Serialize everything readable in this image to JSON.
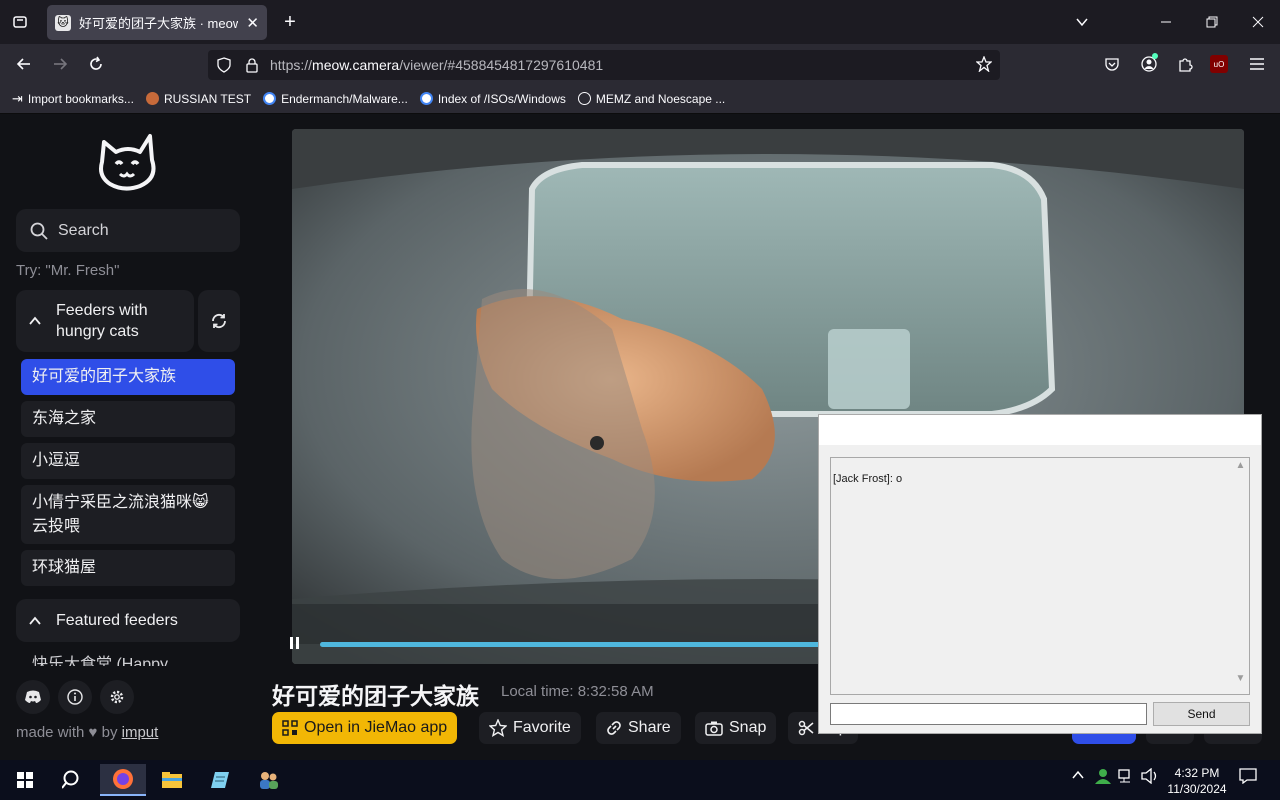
{
  "browser": {
    "tab_title": "好可爱的团子大家族 · meow.ca",
    "tab_close": "✕",
    "new_tab": "+",
    "url_prefix": "https://",
    "url_host": "meow.camera",
    "url_path": "/viewer/#4588454817297610481",
    "bookmarks": [
      {
        "label": "Import bookmarks..."
      },
      {
        "label": "RUSSIAN TEST"
      },
      {
        "label": "Endermanch/Malware..."
      },
      {
        "label": "Index of /ISOs/Windows"
      },
      {
        "label": "MEMZ and Noescape ..."
      }
    ]
  },
  "sidebar": {
    "search_placeholder": "Search",
    "try_hint": "Try: \"Mr. Fresh\"",
    "group1_title": "Feeders with hungry cats",
    "feeders": [
      {
        "label": "好可爱的团子大家族",
        "active": true
      },
      {
        "label": "东海之家"
      },
      {
        "label": "小逗逗"
      },
      {
        "label": "小倩宁采臣之流浪猫咪😸 云投喂"
      },
      {
        "label": "环球猫屋"
      }
    ],
    "group2_title": "Featured feeders",
    "cut_item": "快乐大食堂 (Happy",
    "made_with_prefix": "made with",
    "heart": "♥",
    "made_with_by": "by",
    "made_with_link": "imput"
  },
  "viewer": {
    "camera_title": "好可爱的团子大家族",
    "local_time": "Local time: 8:32:58 AM",
    "progress": 0.56,
    "buttons": {
      "open_app": "Open in JieMao app",
      "favorite": "Favorite",
      "share": "Share",
      "snap": "Snap",
      "clip": "Clip"
    }
  },
  "chat_window": {
    "message": "[Jack Frost]: o",
    "send_label": "Send"
  },
  "taskbar": {
    "time": "4:32 PM",
    "date": "11/30/2024"
  }
}
